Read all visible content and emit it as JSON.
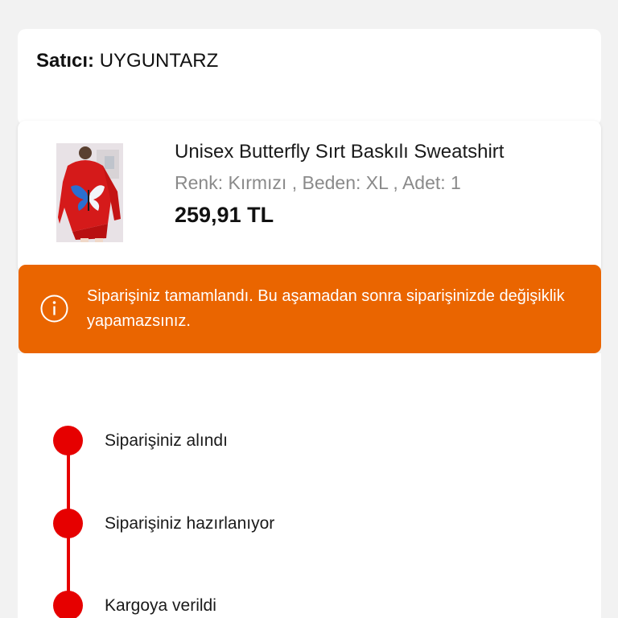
{
  "seller": {
    "label": "Satıcı:",
    "name": "UYGUNTARZ"
  },
  "product": {
    "image_alt": "red hoodie with butterfly print",
    "title": "Unisex Butterfly Sırt Baskılı Sweatshirt",
    "variant": "Renk: Kırmızı , Beden: XL , Adet: 1",
    "price": "259,91 TL"
  },
  "alert": {
    "icon": "info-icon",
    "message": "Siparişiniz tamamlandı. Bu aşamadan sonra siparişinizde değişiklik yapamazsınız.",
    "background_color": "#ea6500"
  },
  "timeline": {
    "accent_color": "#e60000",
    "steps": [
      {
        "label": "Siparişiniz alındı"
      },
      {
        "label": "Siparişiniz hazırlanıyor"
      },
      {
        "label": "Kargoya verildi"
      }
    ]
  }
}
